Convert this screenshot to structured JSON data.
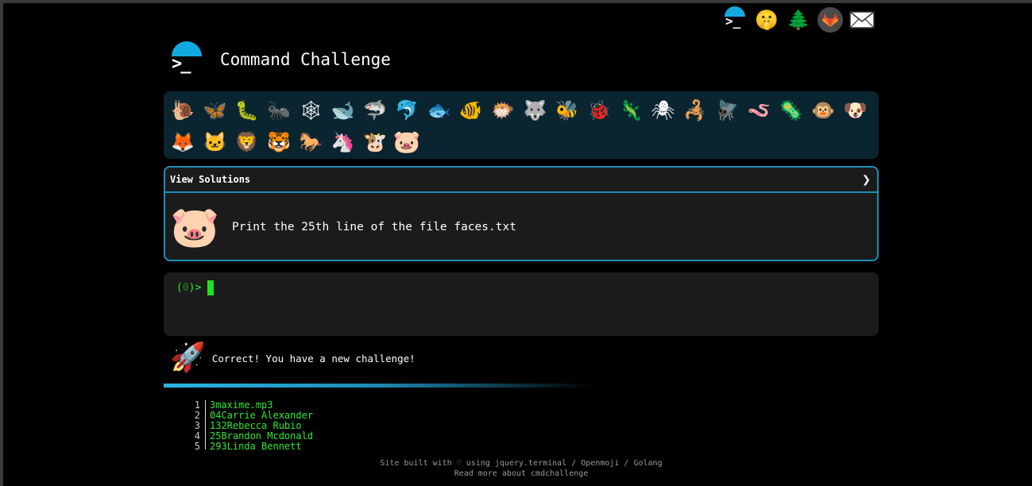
{
  "top_icons": [
    {
      "name": "cmdchallenge-logo-icon"
    },
    {
      "name": "shushing-face-icon",
      "glyph": "🤫"
    },
    {
      "name": "christmas-tree-icon",
      "glyph": "🌲"
    },
    {
      "name": "gitlab-icon"
    },
    {
      "name": "envelope-icon",
      "glyph": "✉"
    }
  ],
  "header": {
    "logo_prompt": ">_",
    "title": "Command Challenge"
  },
  "emoji_bar": {
    "items": [
      {
        "name": "snail",
        "glyph": "🐌"
      },
      {
        "name": "butterfly",
        "glyph": "🦋"
      },
      {
        "name": "caterpillar",
        "glyph": "🐛"
      },
      {
        "name": "ant",
        "glyph": "🐜"
      },
      {
        "name": "spider-web",
        "glyph": "🕸"
      },
      {
        "name": "whale",
        "glyph": "🐋"
      },
      {
        "name": "shark",
        "glyph": "🦈"
      },
      {
        "name": "dolphin",
        "glyph": "🐬"
      },
      {
        "name": "fish",
        "glyph": "🐟"
      },
      {
        "name": "tropical-fish",
        "glyph": "🐠"
      },
      {
        "name": "blowfish",
        "glyph": "🐡"
      },
      {
        "name": "wolf",
        "glyph": "🐺"
      },
      {
        "name": "bee",
        "glyph": "🐝"
      },
      {
        "name": "lady-beetle",
        "glyph": "🐞"
      },
      {
        "name": "lizard",
        "glyph": "🦎"
      },
      {
        "name": "spider",
        "glyph": "🕷"
      },
      {
        "name": "scorpion",
        "glyph": "🦂"
      },
      {
        "name": "fly",
        "glyph": "🪰"
      },
      {
        "name": "worm",
        "glyph": "🪱"
      },
      {
        "name": "microbe",
        "glyph": "🦠"
      },
      {
        "name": "monkey-face",
        "glyph": "🐵"
      },
      {
        "name": "dog-face",
        "glyph": "🐶"
      },
      {
        "name": "fox",
        "glyph": "🦊"
      },
      {
        "name": "cat-face",
        "glyph": "🐱"
      },
      {
        "name": "lion",
        "glyph": "🦁"
      },
      {
        "name": "tiger-face",
        "glyph": "🐯"
      },
      {
        "name": "horse",
        "glyph": "🐎"
      },
      {
        "name": "unicorn",
        "glyph": "🦄"
      },
      {
        "name": "cow-face",
        "glyph": "🐮"
      },
      {
        "name": "pig-face",
        "glyph": "🐷"
      }
    ]
  },
  "challenge": {
    "view_solutions_label": "View Solutions",
    "chevron": "❯",
    "icon_glyph": "🐷",
    "text": "Print the 25th line of the file faces.txt"
  },
  "terminal": {
    "prompt_open": "(",
    "prompt_count": "0",
    "prompt_close": ")>"
  },
  "feedback": {
    "icon_glyph": "🚀",
    "text": "Correct! You have a new challenge!"
  },
  "file_output": {
    "rows": [
      {
        "n": "1",
        "text": "3maxime.mp3"
      },
      {
        "n": "2",
        "text": "04Carrie Alexander"
      },
      {
        "n": "3",
        "text": "132Rebecca Rubio"
      },
      {
        "n": "4",
        "text": "25Brandon Mcdonald"
      },
      {
        "n": "5",
        "text": "293Linda Bennett"
      }
    ]
  },
  "footer": {
    "line1": "Site built with ♡ using jquery.terminal / Openmoji / Golang",
    "line2": "Read more about cmdchallenge"
  }
}
